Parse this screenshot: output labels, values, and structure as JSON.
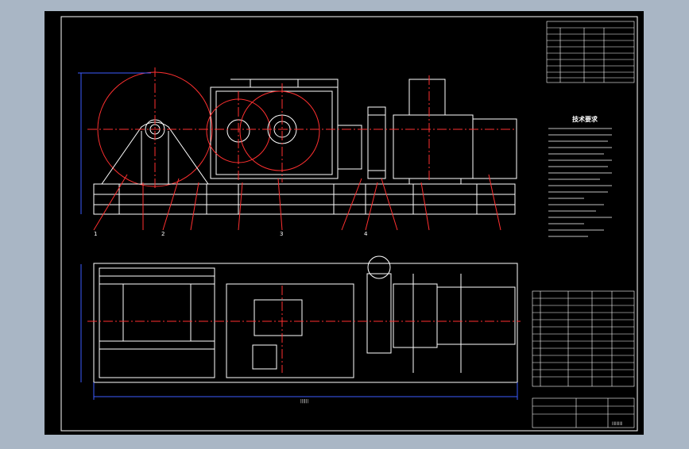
{
  "colors": {
    "viewport_bg": "#a9b6c5",
    "sheet_bg": "#000000",
    "line": "#ffffff",
    "center_line": "#ff3030",
    "dimension": "#3b5bff",
    "leader": "#ff3030"
  },
  "front_view": {
    "part_callouts": [
      "1",
      "2",
      "3",
      "4"
    ],
    "dimension_text": "|||||||||||||||"
  },
  "plan_view": {
    "overall_dimension_text": "||||||"
  },
  "technical_requirements": {
    "title": "技术要求"
  },
  "title_block": {
    "drawing_number": "||||||||||"
  }
}
